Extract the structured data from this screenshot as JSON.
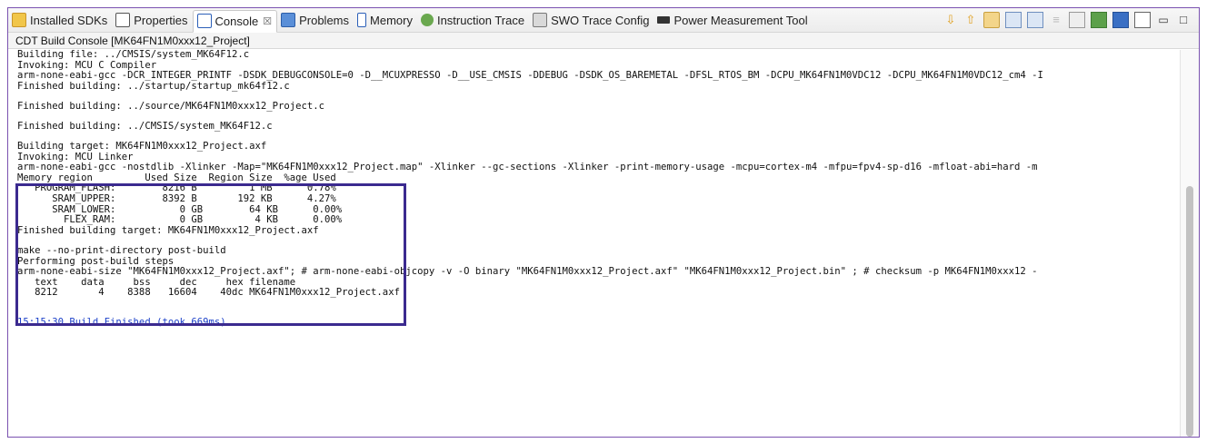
{
  "tabs": [
    {
      "label": "Installed SDKs",
      "icon": "sdk-icon",
      "active": false
    },
    {
      "label": "Properties",
      "icon": "properties-icon",
      "active": false
    },
    {
      "label": "Console",
      "icon": "console-icon",
      "active": true,
      "close": "☒"
    },
    {
      "label": "Problems",
      "icon": "problems-icon",
      "active": false
    },
    {
      "label": "Memory",
      "icon": "memory-icon",
      "active": false
    },
    {
      "label": "Instruction Trace",
      "icon": "instruction-trace-icon",
      "active": false
    },
    {
      "label": "SWO Trace Config",
      "icon": "swo-icon",
      "active": false
    },
    {
      "label": "Power Measurement Tool",
      "icon": "power-icon",
      "active": false
    }
  ],
  "console_title": "CDT Build Console [MK64FN1M0xxx12_Project]",
  "console": {
    "lines": [
      "Building file: ../CMSIS/system_MK64F12.c",
      "Invoking: MCU C Compiler",
      "arm-none-eabi-gcc -DCR_INTEGER_PRINTF -DSDK_DEBUGCONSOLE=0 -D__MCUXPRESSO -D__USE_CMSIS -DDEBUG -DSDK_OS_BAREMETAL -DFSL_RTOS_BM -DCPU_MK64FN1M0VDC12 -DCPU_MK64FN1M0VDC12_cm4 -I",
      "Finished building: ../startup/startup_mk64f12.c",
      "",
      "Finished building: ../source/MK64FN1M0xxx12_Project.c",
      "",
      "Finished building: ../CMSIS/system_MK64F12.c",
      "",
      "Building target: MK64FN1M0xxx12_Project.axf",
      "Invoking: MCU Linker",
      "arm-none-eabi-gcc -nostdlib -Xlinker -Map=\"MK64FN1M0xxx12_Project.map\" -Xlinker --gc-sections -Xlinker -print-memory-usage -mcpu=cortex-m4 -mfpu=fpv4-sp-d16 -mfloat-abi=hard -m",
      "Memory region         Used Size  Region Size  %age Used",
      "   PROGRAM_FLASH:        8216 B         1 MB      0.78%",
      "      SRAM_UPPER:        8392 B       192 KB      4.27%",
      "      SRAM_LOWER:           0 GB        64 KB      0.00%",
      "        FLEX_RAM:           0 GB         4 KB      0.00%",
      "Finished building target: MK64FN1M0xxx12_Project.axf",
      "",
      "make --no-print-directory post-build",
      "Performing post-build steps",
      "arm-none-eabi-size \"MK64FN1M0xxx12_Project.axf\"; # arm-none-eabi-objcopy -v -O binary \"MK64FN1M0xxx12_Project.axf\" \"MK64FN1M0xxx12_Project.bin\" ; # checksum -p MK64FN1M0xxx12 -",
      "   text    data     bss     dec     hex filename",
      "   8212       4    8388   16604    40dc MK64FN1M0xxx12_Project.axf",
      "",
      "",
      "15:15:30 Build Finished (took 669ms)"
    ]
  },
  "colors": {
    "highlight_border": "#3b2a8f",
    "build_finished_text": "#1a3fc8"
  },
  "toolbar_icons": [
    "download-arrow-icon",
    "upload-arrow-icon",
    "scroll-lock-icon",
    "show-console-icon",
    "clear-console-icon",
    "word-wrap-icon",
    "pin-console-icon",
    "new-console-icon",
    "display-selected-console-icon",
    "open-console-icon",
    "minimize-icon",
    "maximize-icon"
  ]
}
